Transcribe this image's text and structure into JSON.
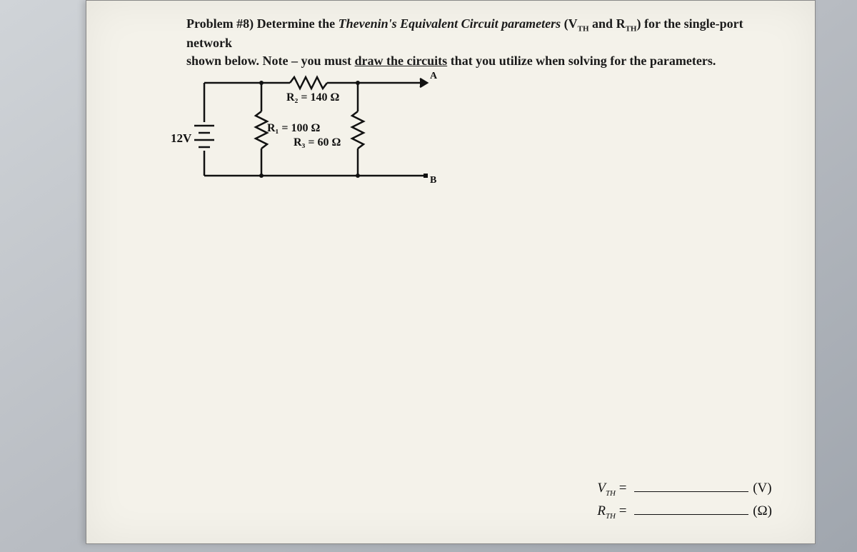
{
  "problem": {
    "prefix": "Problem #8)",
    "line1a": "Determine the ",
    "line1b_italic": "Thevenin's Equivalent Circuit parameters",
    "line1c": " (V",
    "sub_th1": "TH",
    "line1d": " and R",
    "sub_th2": "TH",
    "line1e": ") for the single-port network",
    "line2a": "shown below.   Note – you must ",
    "line2b_underline": "draw the circuits",
    "line2c": " that you utilize when solving for the parameters."
  },
  "source": {
    "label": "12V"
  },
  "resistors": {
    "r2": "R₂ = 140 Ω",
    "r1": "R₁ = 100 Ω",
    "r3": "R₃ = 60 Ω"
  },
  "terminals": {
    "a": "A",
    "b": "B"
  },
  "answers": {
    "vth_label": "V",
    "vth_sub": "TH",
    "vth_eq": " = ",
    "vth_unit": "(V)",
    "rth_label": "R",
    "rth_sub": "TH",
    "rth_eq": " = ",
    "rth_unit": "(Ω)"
  }
}
